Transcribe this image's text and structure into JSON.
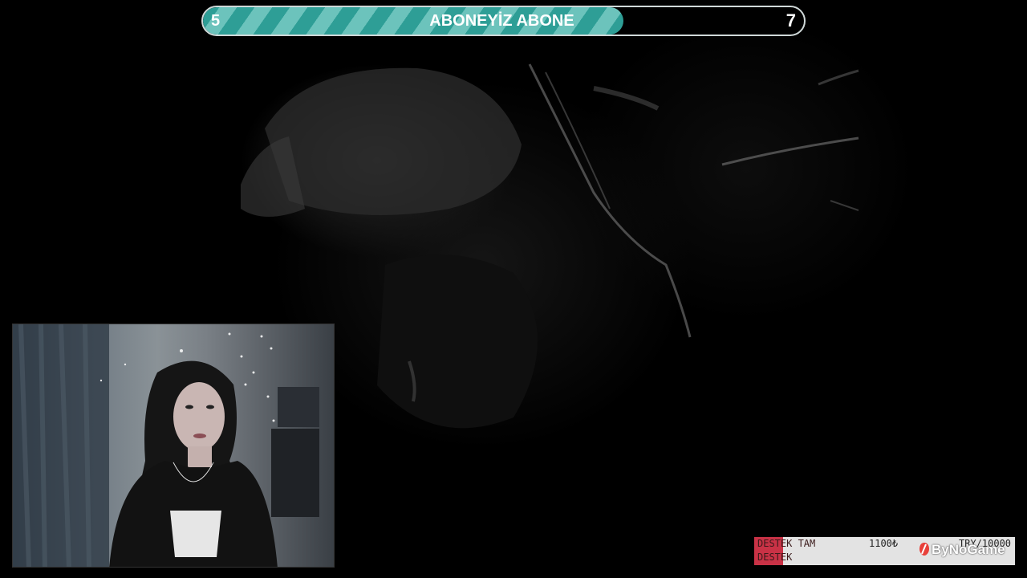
{
  "goal_bar": {
    "start_value": "5",
    "end_value": "7",
    "title": "ABONEYİZ ABONE",
    "progress": 0.7,
    "colors": {
      "stripe_dark": "#2e9e96",
      "stripe_light": "#6cc3bc",
      "border": "#cfd8d8"
    }
  },
  "destek_widget": {
    "row1_label": "DESTEK TAM",
    "row2_label": "DESTEK",
    "amount": "1100₺",
    "target": "TRY/10000",
    "brand": "ByNoGame",
    "brand_icon": "bynogame-logo-icon",
    "colors": {
      "accent": "#c93246",
      "background": "#e3e3e3"
    }
  },
  "webcam": {
    "label": "streamer-webcam"
  }
}
